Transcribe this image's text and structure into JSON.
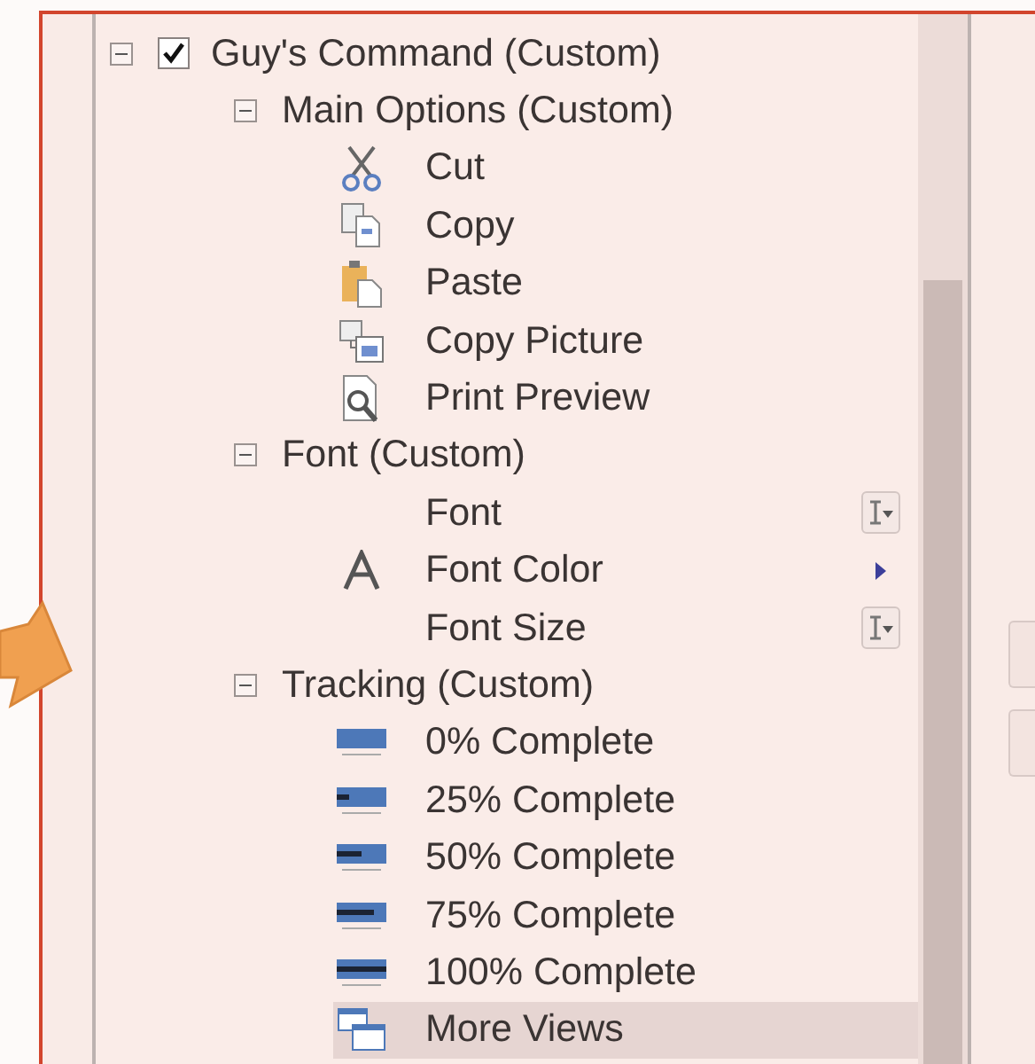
{
  "tree": [
    {
      "label": "Guy's Command (Custom)",
      "expanded": true,
      "checked": true,
      "children": [
        {
          "label": "Main Options (Custom)",
          "expanded": true,
          "children": [
            {
              "label": "Cut",
              "kind": "cut",
              "selected": false
            },
            {
              "label": "Copy",
              "kind": "copy",
              "selected": false
            },
            {
              "label": "Paste",
              "kind": "paste",
              "selected": false
            },
            {
              "label": "Copy Picture",
              "kind": "picture",
              "selected": false
            },
            {
              "label": "Print Preview",
              "kind": "preview",
              "selected": false
            }
          ]
        },
        {
          "label": "Font (Custom)",
          "expanded": true,
          "children": [
            {
              "label": "Font",
              "kind": "plain",
              "control": {
                "kind": "dropdown"
              },
              "selected": false
            },
            {
              "label": "Font Color",
              "kind": "letter",
              "control": {
                "kind": "submenu"
              },
              "selected": false
            },
            {
              "label": "Font Size",
              "kind": "plain",
              "control": {
                "kind": "dropdown"
              },
              "selected": false
            }
          ]
        },
        {
          "label": "Tracking (Custom)",
          "expanded": true,
          "children": [
            {
              "label": "0% Complete",
              "kind": "progress",
              "selected": false
            },
            {
              "label": "25% Complete",
              "kind": "progress",
              "selected": false
            },
            {
              "label": "50% Complete",
              "kind": "progress",
              "selected": false
            },
            {
              "label": "75% Complete",
              "kind": "progress",
              "selected": false
            },
            {
              "label": "100% Complete",
              "kind": "progress",
              "selected": false
            },
            {
              "label": "More Views",
              "kind": "views",
              "selected": true
            }
          ]
        }
      ]
    }
  ]
}
